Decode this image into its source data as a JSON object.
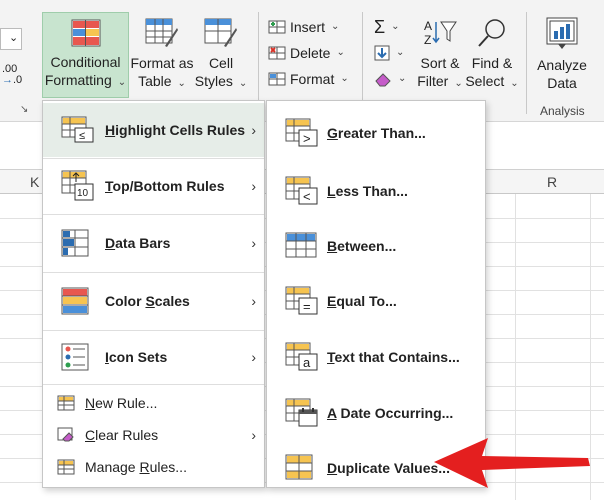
{
  "ribbon": {
    "conditional_formatting": {
      "line1": "Conditional",
      "line2": "Formatting"
    },
    "format_as_table": {
      "line1": "Format as",
      "line2": "Table"
    },
    "cell_styles": {
      "line1": "Cell",
      "line2": "Styles"
    },
    "insert": "Insert",
    "delete": "Delete",
    "format": "Format",
    "sigma": "Σ",
    "sort_filter": {
      "line1": "Sort &",
      "line2": "Filter"
    },
    "find_select": {
      "line1": "Find &",
      "line2": "Select"
    },
    "analyze_data": {
      "line1": "Analyze",
      "line2": "Data"
    },
    "analysis_group": "Analysis",
    "number_format_hint": ".00\n→.0"
  },
  "columns": {
    "k": "K",
    "r": "R"
  },
  "main_menu": {
    "items": [
      {
        "label": "Highlight Cells Rules",
        "underline": "H",
        "rest": "ighlight Cells Rules",
        "has_submenu": true,
        "active": true
      },
      {
        "label": "Top/Bottom Rules",
        "underline": "T",
        "rest": "op/Bottom Rules",
        "has_submenu": true
      },
      {
        "label": "Data Bars",
        "underline": "D",
        "rest": "ata Bars",
        "has_submenu": true
      },
      {
        "label": "Color Scales",
        "underline": "S",
        "pre": "Color ",
        "rest": "cales",
        "has_submenu": true
      },
      {
        "label": "Icon Sets",
        "underline": "I",
        "rest": "con Sets",
        "has_submenu": true
      }
    ],
    "new_rule": {
      "pre": "",
      "u": "N",
      "rest": "ew Rule..."
    },
    "clear_rules": {
      "pre": "",
      "u": "C",
      "rest": "lear Rules"
    },
    "manage_rules": {
      "pre": "Manage ",
      "u": "R",
      "rest": "ules..."
    }
  },
  "submenu": {
    "items": [
      {
        "u": "G",
        "rest": "reater Than..."
      },
      {
        "u": "L",
        "rest": "ess Than..."
      },
      {
        "u": "B",
        "rest": "etween..."
      },
      {
        "u": "E",
        "rest": "qual To..."
      },
      {
        "u": "T",
        "rest": "ext that Contains..."
      },
      {
        "u": "A",
        "rest": " Date Occurring..."
      },
      {
        "u": "D",
        "rest": "uplicate Values..."
      }
    ]
  },
  "colors": {
    "accent_green": "#c8e4cf",
    "arrow_red": "#e41f1f"
  }
}
